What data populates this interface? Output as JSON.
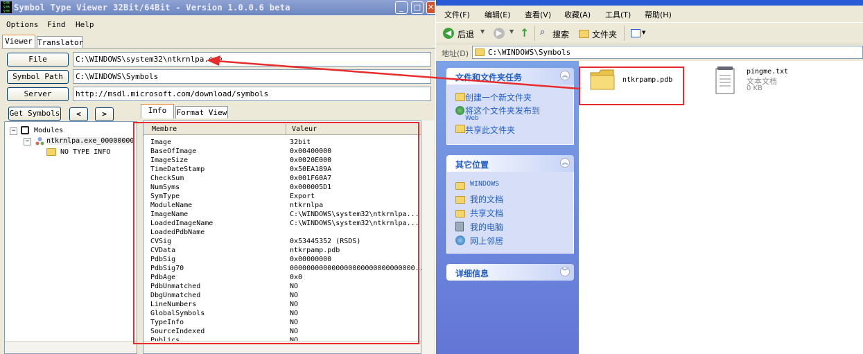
{
  "stv": {
    "title": "Symbol Type Viewer 32Bit/64Bit - Version 1.0.0.6 beta",
    "window_buttons": {
      "minimize": "_",
      "maximize": "□",
      "close": "✕"
    },
    "menu": [
      "Options",
      "Find",
      "Help"
    ],
    "tabs": [
      "Viewer",
      "Translator"
    ],
    "file_button": "File",
    "file_value": "C:\\WINDOWS\\system32\\ntkrnlpa.exe",
    "symbol_path_button": "Symbol Path",
    "symbol_path_value": "C:\\WINDOWS\\Symbols",
    "server_button": "Server",
    "server_value": "http://msdl.microsoft.com/download/symbols",
    "get_symbols_button": "Get Symbols",
    "prev_button": "<",
    "next_button": ">",
    "tree": {
      "root": "Modules",
      "module": "ntkrnlpa.exe_00000000",
      "child": "NO TYPE INFO"
    },
    "info_tabs": [
      "Info",
      "Format View"
    ],
    "columns": [
      "Membre",
      "Valeur"
    ],
    "rows": [
      [
        "Image",
        "32bit"
      ],
      [
        "BaseOfImage",
        "0x00400000"
      ],
      [
        "ImageSize",
        "0x0020E000"
      ],
      [
        "TimeDateStamp",
        "0x50EA189A"
      ],
      [
        "CheckSum",
        "0x001F60A7"
      ],
      [
        "NumSyms",
        "0x000005D1"
      ],
      [
        "SymType",
        "Export"
      ],
      [
        "ModuleName",
        "ntkrnlpa"
      ],
      [
        "ImageName",
        "C:\\WINDOWS\\system32\\ntkrnlpa..."
      ],
      [
        "LoadedImageName",
        "C:\\WINDOWS\\system32\\ntkrnlpa..."
      ],
      [
        "LoadedPdbName",
        ""
      ],
      [
        "CVSig",
        "0x53445352 (RSDS)"
      ],
      [
        "CVData",
        "ntkrpamp.pdb"
      ],
      [
        "PdbSig",
        "0x00000000"
      ],
      [
        "PdbSig70",
        "000000000000000000000000000000..."
      ],
      [
        "PdbAge",
        "0x0"
      ],
      [
        "PdbUnmatched",
        "NO"
      ],
      [
        "DbgUnmatched",
        "NO"
      ],
      [
        "LineNumbers",
        "NO"
      ],
      [
        "GlobalSymbols",
        "NO"
      ],
      [
        "TypeInfo",
        "NO"
      ],
      [
        "SourceIndexed",
        "NO"
      ],
      [
        "Publics",
        "NO"
      ]
    ]
  },
  "explorer": {
    "menu": [
      "文件(F)",
      "编辑(E)",
      "查看(V)",
      "收藏(A)",
      "工具(T)",
      "帮助(H)"
    ],
    "toolbar": {
      "back": "后退",
      "search": "搜索",
      "folders": "文件夹"
    },
    "address_label": "地址(D)",
    "address_value": "C:\\WINDOWS\\Symbols",
    "tasks_panel": {
      "title": "文件和文件夹任务",
      "items": [
        "创建一个新文件夹",
        "将这个文件夹发布到",
        "Web",
        "共享此文件夹"
      ]
    },
    "places_panel": {
      "title": "其它位置",
      "items": [
        "WINDOWS",
        "我的文档",
        "共享文档",
        "我的电脑",
        "网上邻居"
      ]
    },
    "details_panel": {
      "title": "详细信息"
    },
    "files": [
      {
        "name": "ntkrpamp.pdb",
        "type": "",
        "size": ""
      },
      {
        "name": "pingme.txt",
        "type": "文本文档",
        "size": "0 KB"
      }
    ]
  },
  "colors": {
    "annotation": "#e82c2c",
    "xp_blue": "#2a5bd6",
    "task_link": "#215dc6"
  }
}
